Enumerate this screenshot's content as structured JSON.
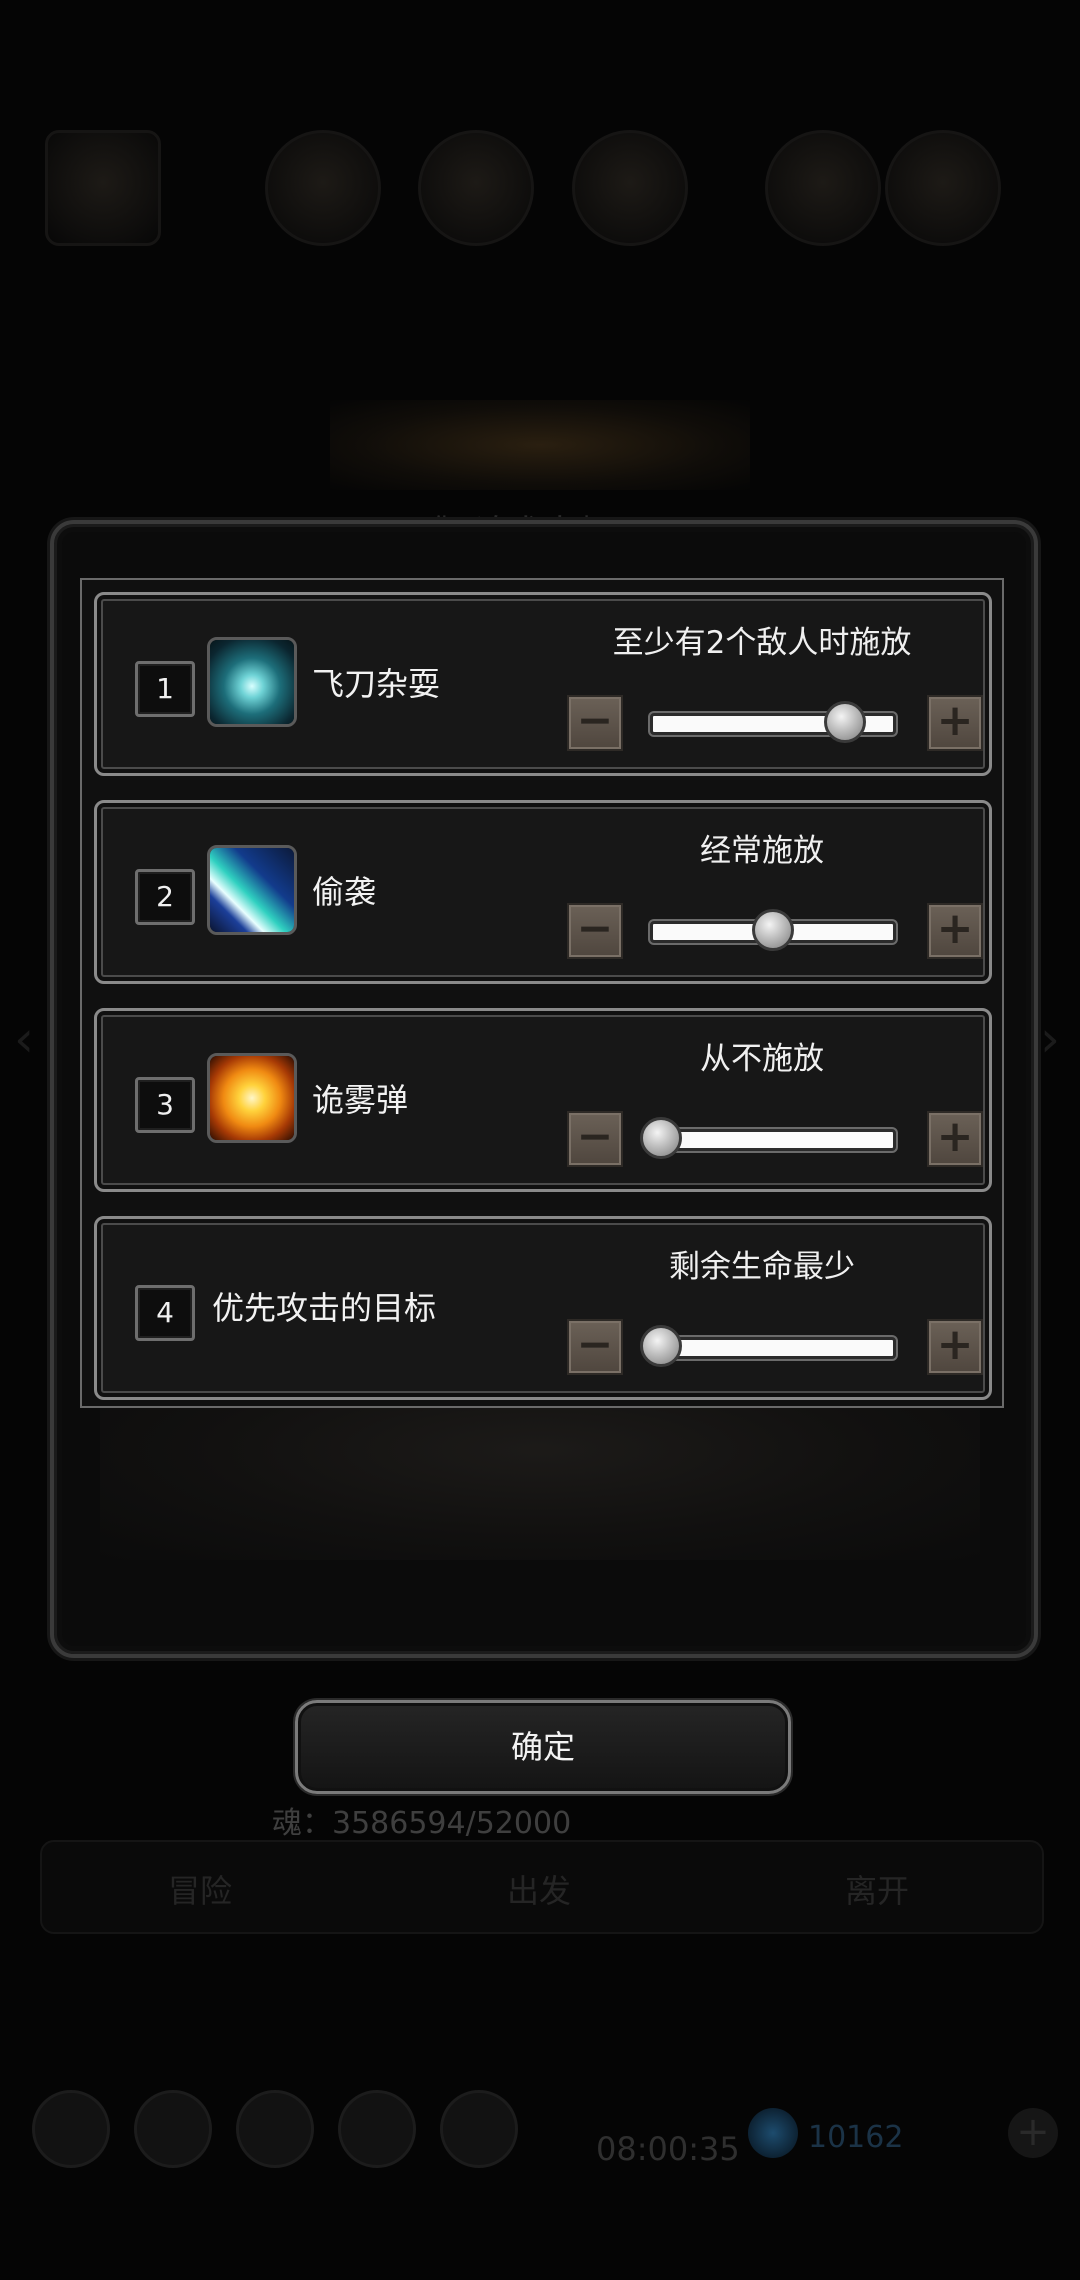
{
  "dialog": {
    "rows": [
      {
        "number": "1",
        "skill_name": "飞刀杂耍",
        "mode_label": "至少有2个敌人时施放",
        "level": 0.82,
        "icon": "flying-knives-icon"
      },
      {
        "number": "2",
        "skill_name": "偷袭",
        "mode_label": "经常施放",
        "level": 0.5,
        "icon": "sneak-attack-icon"
      },
      {
        "number": "3",
        "skill_name": "诡雾弹",
        "mode_label": "从不施放",
        "level": 0.0,
        "icon": "smoke-bomb-icon"
      },
      {
        "number": "4",
        "skill_name": "优先攻击的目标",
        "mode_label": "剩余生命最少",
        "level": 0.0,
        "icon": ""
      }
    ],
    "minus_symbol": "−",
    "plus_symbol": "+",
    "confirm_label": "确定"
  },
  "background": {
    "soul_text": "魂：3586594/52000",
    "tabs": [
      "冒险",
      "出发",
      "离开"
    ],
    "clock": "08:00:35",
    "counter": "10162",
    "add_symbol": "+",
    "subtitle": "伽  追术大师"
  },
  "colors": {
    "stepper_button": "#5e554c",
    "slider_track": "#fafafa",
    "panel_border": "#8a8a8a"
  }
}
